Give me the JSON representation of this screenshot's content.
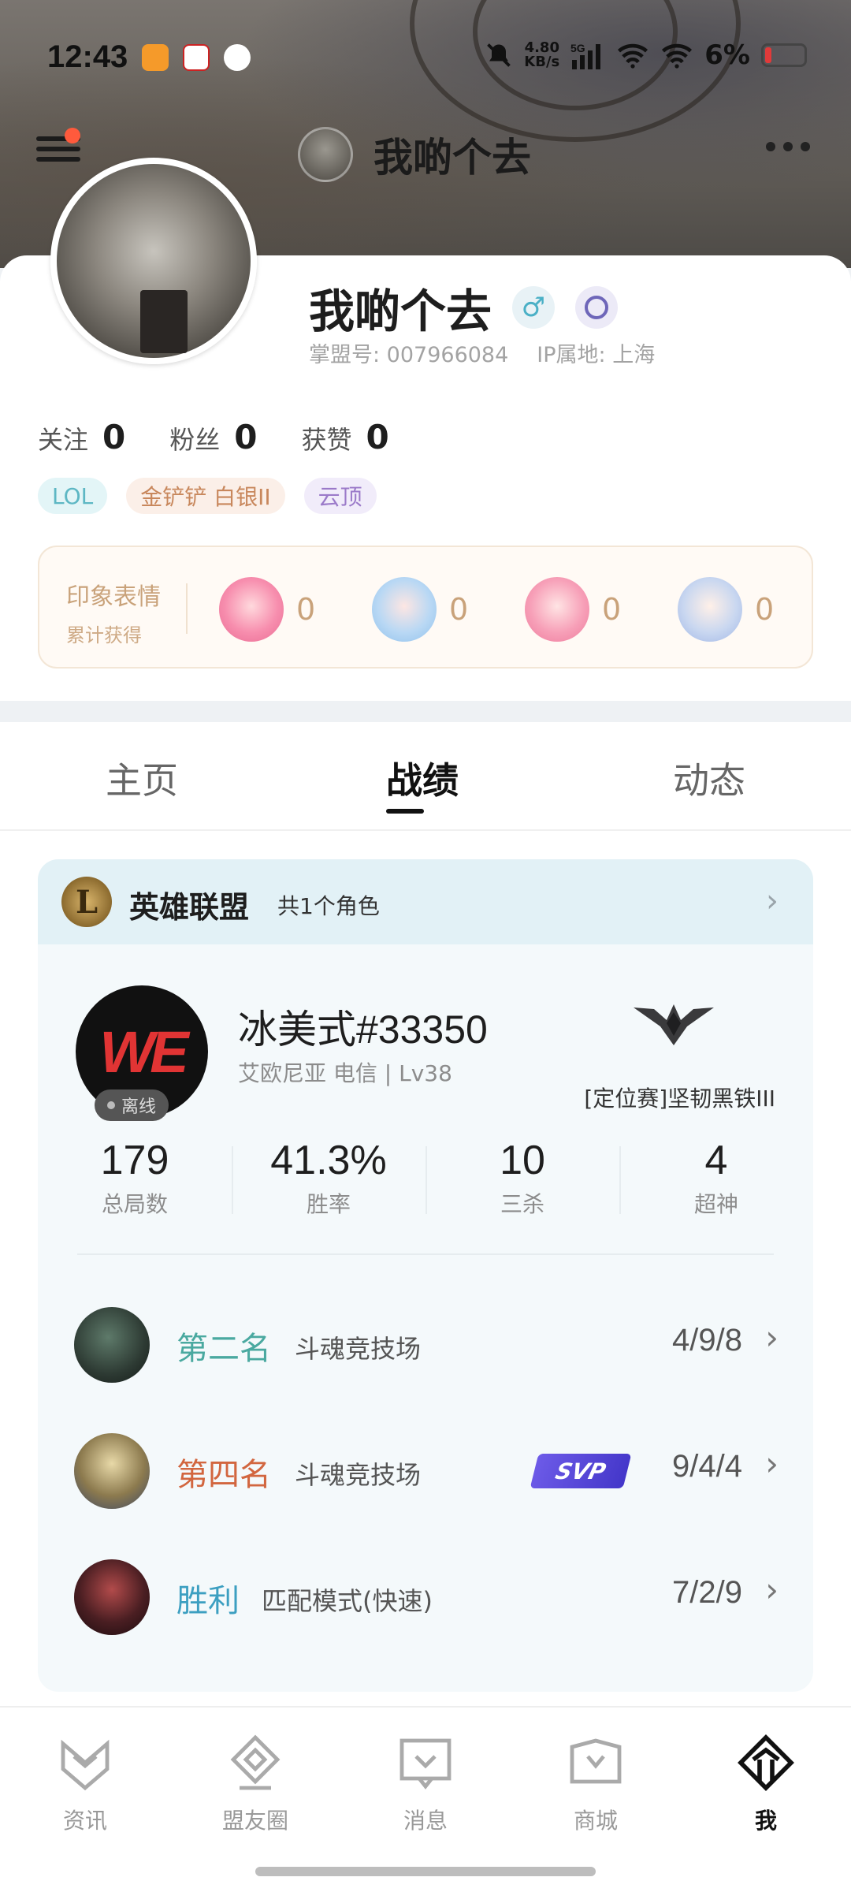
{
  "status_bar": {
    "time": "12:43",
    "net_speed_value": "4.80",
    "net_speed_unit": "KB/s",
    "network": "5G",
    "battery": "6%"
  },
  "top_nav": {
    "title": "我啲个去"
  },
  "profile": {
    "username": "我啲个去",
    "gender_symbol": "♂",
    "account_id": "掌盟号: 007966084",
    "ip_location": "IP属地: 上海",
    "follow_label": "关注",
    "follow_count": "0",
    "fans_label": "粉丝",
    "fans_count": "0",
    "likes_label": "获赞",
    "likes_count": "0",
    "tags": [
      "LOL",
      "金铲铲 白银II",
      "云顶"
    ]
  },
  "impressions": {
    "title": "印象表情",
    "subtitle": "累计获得",
    "counts": [
      "0",
      "0",
      "0",
      "0"
    ]
  },
  "tabs": {
    "items": [
      "主页",
      "战绩",
      "动态"
    ],
    "active": "战绩"
  },
  "records": {
    "game_title": "英雄联盟",
    "role_count": "共1个角色",
    "player": {
      "name": "冰美式#33350",
      "meta": "艾欧尼亚  电信 | Lv38",
      "status": "离线",
      "rank": "[定位赛]坚韧黑铁III",
      "team_logo_text": "WE"
    },
    "stats": [
      {
        "value": "179",
        "label": "总局数"
      },
      {
        "value": "41.3%",
        "label": "胜率"
      },
      {
        "value": "10",
        "label": "三杀"
      },
      {
        "value": "4",
        "label": "超神"
      }
    ],
    "matches": [
      {
        "result": "第二名",
        "mode": "斗魂竞技场",
        "kda": "4/9/8",
        "color": "#4aa9a0"
      },
      {
        "result": "第四名",
        "mode": "斗魂竞技场",
        "kda": "9/4/4",
        "badge": "SVP",
        "color": "#d2663f"
      },
      {
        "result": "胜利",
        "mode": "匹配模式(快速)",
        "kda": "7/2/9",
        "color": "#3c9fc1"
      }
    ]
  },
  "bottom_nav": {
    "items": [
      "资讯",
      "盟友圈",
      "消息",
      "商城",
      "我"
    ],
    "active": "我"
  },
  "colors": {
    "accent_red": "#ff5a3c",
    "impress_gold": "#c9a27a"
  }
}
